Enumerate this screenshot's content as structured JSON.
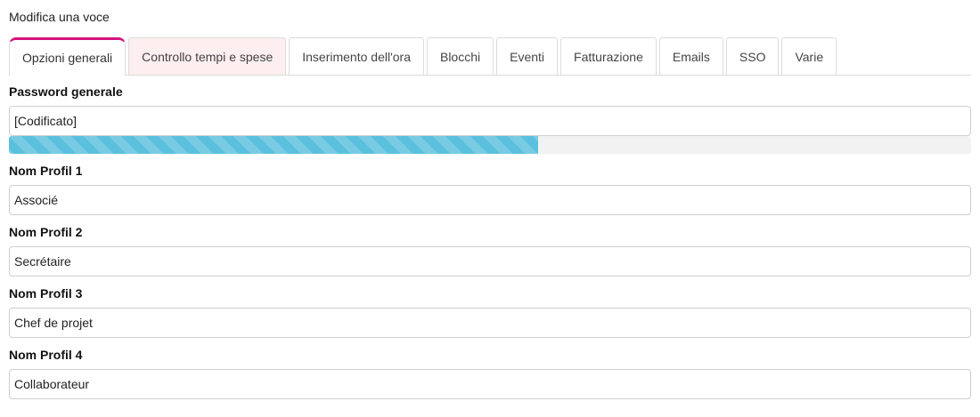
{
  "page": {
    "heading": "Modifica una voce"
  },
  "tabs": [
    {
      "label": "Opzioni generali",
      "active": true
    },
    {
      "label": "Controllo tempi e spese",
      "hover": true
    },
    {
      "label": "Inserimento dell'ora"
    },
    {
      "label": "Blocchi"
    },
    {
      "label": "Eventi"
    },
    {
      "label": "Fatturazione"
    },
    {
      "label": "Emails"
    },
    {
      "label": "SSO"
    },
    {
      "label": "Varie"
    }
  ],
  "form": {
    "password": {
      "label": "Password generale",
      "value": "[Codificato]",
      "strength_fraction": 0.55
    },
    "profil1": {
      "label": "Nom Profil 1",
      "value": "Associé"
    },
    "profil2": {
      "label": "Nom Profil 2",
      "value": "Secrétaire"
    },
    "profil3": {
      "label": "Nom Profil 3",
      "value": "Chef de projet"
    },
    "profil4": {
      "label": "Nom Profil 4",
      "value": "Collaborateur"
    }
  },
  "colors": {
    "active_tab_accent": "#d4147b",
    "progress_fill": "#5bc0de",
    "hover_tab_bg": "#fdeef0"
  }
}
